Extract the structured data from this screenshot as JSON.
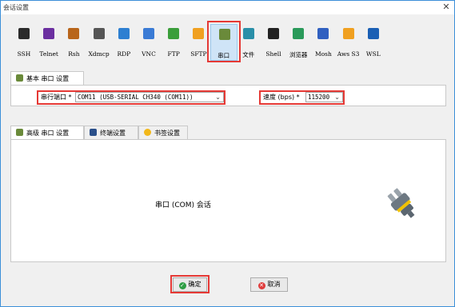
{
  "window": {
    "title": "会话设置",
    "close": "✕"
  },
  "protocols": [
    {
      "label": "SSH",
      "icon": "wrench-icon",
      "color": "#2b2b2b"
    },
    {
      "label": "Telnet",
      "icon": "telnet-icon",
      "color": "#6b2fa0"
    },
    {
      "label": "Rsh",
      "icon": "rsh-icon",
      "color": "#b8651a"
    },
    {
      "label": "Xdmcp",
      "icon": "xdmcp-icon",
      "color": "#555555"
    },
    {
      "label": "RDP",
      "icon": "rdp-icon",
      "color": "#2d7fd1"
    },
    {
      "label": "VNC",
      "icon": "vnc-icon",
      "color": "#3a7bd5"
    },
    {
      "label": "FTP",
      "icon": "ftp-icon",
      "color": "#3a9e3a"
    },
    {
      "label": "SFTP",
      "icon": "sftp-icon",
      "color": "#f0a020"
    },
    {
      "label": "串口",
      "icon": "serial-plug-icon",
      "color": "#6a8a3a"
    },
    {
      "label": "文件",
      "icon": "file-icon",
      "color": "#2a8fa8"
    },
    {
      "label": "Shell",
      "icon": "shell-icon",
      "color": "#222222"
    },
    {
      "label": "浏览器",
      "icon": "browser-icon",
      "color": "#2a9a5a"
    },
    {
      "label": "Mosh",
      "icon": "mosh-icon",
      "color": "#3060c0"
    },
    {
      "label": "Aws S3",
      "icon": "aws-s3-icon",
      "color": "#f0a020"
    },
    {
      "label": "WSL",
      "icon": "wsl-icon",
      "color": "#1a5fb4"
    }
  ],
  "selected_protocol": "串口",
  "basic": {
    "tab_label": "基本 串口 设置",
    "port_label": "串行端口 *",
    "port_value": "COM11  (USB-SERIAL CH340 (COM11))",
    "speed_label": "速度 (bps) *",
    "speed_value": "115200"
  },
  "advanced_tabs": [
    "高级 串口 设置",
    "终端设置",
    "书签设置"
  ],
  "main": {
    "session_text": "串口 (COM) 会话"
  },
  "buttons": {
    "ok": "确定",
    "cancel": "取消"
  },
  "colors": {
    "accent_red": "#e53935",
    "ok_green": "#2e9e44",
    "cancel_red": "#e03c3c"
  }
}
